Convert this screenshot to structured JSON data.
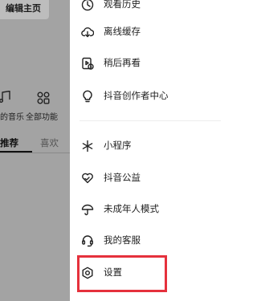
{
  "background": {
    "edit_button": "编辑主页",
    "icons": [
      {
        "icon": "music-note-icon",
        "label": "的音乐"
      },
      {
        "icon": "grid-icon",
        "label": "全部功能"
      }
    ],
    "tabs": [
      "推荐",
      "喜欢"
    ]
  },
  "drawer": {
    "items": [
      {
        "icon": "history-icon",
        "label": "观看历史"
      },
      {
        "icon": "cloud-download-icon",
        "label": "离线缓存"
      },
      {
        "icon": "watch-later-icon",
        "label": "稍后再看"
      },
      {
        "icon": "lightbulb-icon",
        "label": "抖音创作者中心"
      },
      {
        "icon": "mini-program-icon",
        "label": "小程序"
      },
      {
        "icon": "heart-hands-icon",
        "label": "抖音公益"
      },
      {
        "icon": "umbrella-icon",
        "label": "未成年人模式"
      },
      {
        "icon": "customer-service-icon",
        "label": "我的客服"
      },
      {
        "icon": "gear-icon",
        "label": "设置"
      }
    ]
  },
  "highlight": {
    "target": "设置",
    "color": "#e5313c"
  }
}
